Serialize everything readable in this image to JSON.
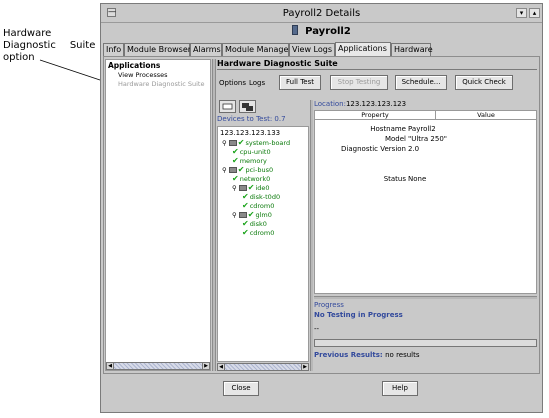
{
  "callout": {
    "line1": "Hardware",
    "line2a": "Diagnostic",
    "line2b": "Suite",
    "line3": "option"
  },
  "window": {
    "title": "Payroll2 Details",
    "subtitle": "Payroll2",
    "dash_glyph": "—",
    "btn_minimize": "▾",
    "btn_maximize": "▴"
  },
  "tabs": [
    "Info",
    "Module Browser",
    "Alarms",
    "Module Manager",
    "View Logs",
    "Applications",
    "Hardware"
  ],
  "active_tab": "Applications",
  "left_pane": {
    "heading": "Applications",
    "items": [
      "View Processes",
      "Hardware Diagnostic Suite"
    ]
  },
  "suite": {
    "title": "Hardware Diagnostic Suite",
    "link_options": "Options",
    "link_logs": "Logs",
    "buttons": {
      "full_test": "Full Test",
      "stop_testing": "Stop Testing",
      "schedule": "Schedule...",
      "quick_check": "Quick Check"
    }
  },
  "tree": {
    "header": "Devices to Test: 0.7",
    "root": "123.123.123.133",
    "nodes": [
      {
        "label": "system-board",
        "depth": 1,
        "type": "group"
      },
      {
        "label": "cpu-unit0",
        "depth": 2,
        "type": "leaf"
      },
      {
        "label": "memory",
        "depth": 2,
        "type": "leaf"
      },
      {
        "label": "pci-bus0",
        "depth": 1,
        "type": "group"
      },
      {
        "label": "network0",
        "depth": 2,
        "type": "leaf"
      },
      {
        "label": "ide0",
        "depth": 2,
        "type": "group"
      },
      {
        "label": "disk-t0d0",
        "depth": 3,
        "type": "leaf"
      },
      {
        "label": "cdrom0",
        "depth": 3,
        "type": "leaf"
      },
      {
        "label": "glm0",
        "depth": 2,
        "type": "group"
      },
      {
        "label": "disk0",
        "depth": 3,
        "type": "leaf"
      },
      {
        "label": "cdrom0",
        "depth": 3,
        "type": "leaf"
      }
    ]
  },
  "props": {
    "location_label": "Location:",
    "location_value": "123.123.123.123",
    "col_property": "Property",
    "col_value": "Value",
    "rows": [
      {
        "key": "Hostname",
        "value": "Payroll2"
      },
      {
        "key": "Model",
        "value": "\"Ultra 250\""
      },
      {
        "key": "Diagnostic Version",
        "value": "2.0"
      },
      {
        "key": "Status",
        "value": "None"
      }
    ]
  },
  "progress": {
    "title": "Progress",
    "status": "No Testing in Progress",
    "dash": "--",
    "percent": 0,
    "previous_label": "Previous Results:",
    "previous_value": "no results"
  },
  "footer": {
    "close": "Close",
    "help": "Help"
  }
}
